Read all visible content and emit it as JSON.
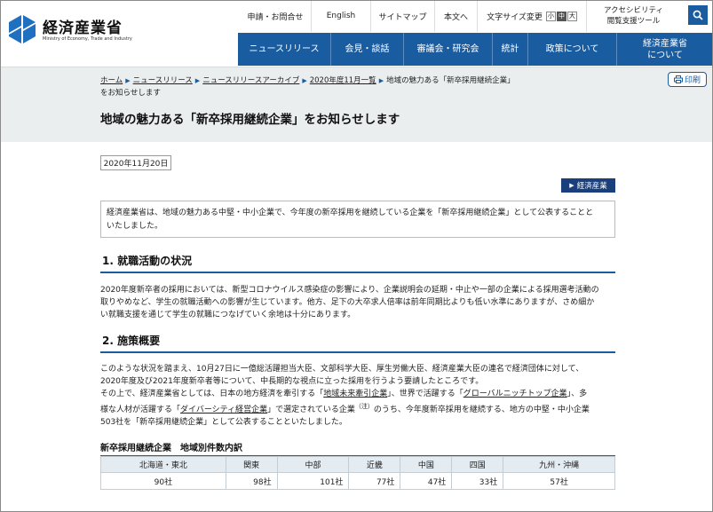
{
  "header": {
    "logo_name": "経済産業省",
    "logo_sub": "Ministry of Economy, Trade and Industry",
    "util": {
      "inquiry": "申請・お問合せ",
      "english": "English",
      "sitemap": "サイトマップ",
      "skip": "本文へ",
      "font_size_label": "文字サイズ変更",
      "font_small": "小",
      "font_medium": "中",
      "font_large": "大",
      "accessibility_line1": "アクセシビリティ",
      "accessibility_line2": "閲覧支援ツール"
    },
    "nav": {
      "news": "ニュースリリース",
      "press": "会見・談話",
      "council": "審議会・研究会",
      "stats": "統計",
      "policy": "政策について",
      "about_line1": "経済産業省",
      "about_line2": "について"
    }
  },
  "breadcrumb": {
    "home": "ホーム",
    "news": "ニュースリリース",
    "archive": "ニュースリリースアーカイブ",
    "month": "2020年度11月一覧",
    "current_line1": "地域の魅力ある「新卒採用継続企業」",
    "current_line2": "をお知らせします"
  },
  "print_label": "印刷",
  "page_title": "地域の魅力ある「新卒採用継続企業」をお知らせします",
  "date": "2020年11月20日",
  "category_tag": "経済産業",
  "summary": {
    "line1": "経済産業省は、地域の魅力ある中堅・中小企業で、今年度の新卒採用を継続している企業を「新卒採用継続企業」として公表することと",
    "line2": "いたしました。"
  },
  "section1": {
    "heading": "1.  就職活動の状況",
    "line1": "2020年度新卒者の採用においては、新型コロナウイルス感染症の影響により、企業説明会の延期・中止や一部の企業による採用選考活動の",
    "line2": "取りやめなど、学生の就職活動への影響が生じています。他方、足下の大卒求人倍率は前年同期比よりも低い水準にありますが、さめ細か",
    "line3": "い就職支援を通じて学生の就職につなげていく余地は十分にあります。"
  },
  "section2": {
    "heading": "2.  施策概要",
    "p1_line1": "このような状況を踏まえ、10月27日に一億総活躍担当大臣、文部科学大臣、厚生労働大臣、経済産業大臣の連名で経済団体に対して、",
    "p1_line2": "2020年度及び2021年度新卒者等について、中長期的な視点に立った採用を行うよう要請したところです。",
    "p2_a": "その上で、経済産業省としては、日本の地方経済を牽引する「",
    "p2_link1": "地域未来牽引企業",
    "p2_b": "」、世界で活躍する「",
    "p2_link2": "グローバルニッチトップ企業",
    "p2_c": "」、多",
    "p2_d": "様な人材が活躍する「",
    "p2_link3": "ダイバーシティ経営企業",
    "p2_e": "」で選定されている企業",
    "p2_note": "（注）",
    "p2_f": "のうち、今年度新卒採用を継続する、地方の中堅・中小企業",
    "p2_g": "503社を「新卒採用継続企業」として公表することといたしました。"
  },
  "table": {
    "title": "新卒採用継続企業　地域別件数内訳",
    "headers": [
      "北海道・東北",
      "関東",
      "中部",
      "近畿",
      "中国",
      "四国",
      "九州・沖縄"
    ],
    "values": [
      "90社",
      "98社",
      "101社",
      "77社",
      "47社",
      "33社",
      "57社"
    ]
  },
  "colors": {
    "primary": "#1a5ca0",
    "band": "#ebeeef",
    "tag": "#1a3f7a",
    "table_header": "#e4ecf2"
  }
}
